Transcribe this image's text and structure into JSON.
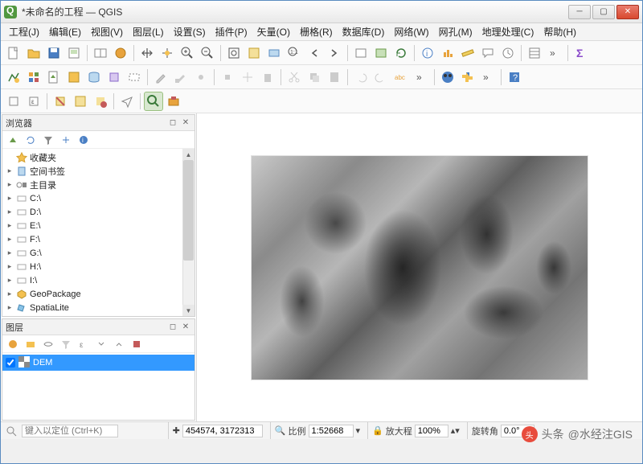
{
  "window": {
    "title": "*未命名的工程 — QGIS"
  },
  "menu": {
    "items": [
      "工程(J)",
      "编辑(E)",
      "视图(V)",
      "图层(L)",
      "设置(S)",
      "插件(P)",
      "矢量(O)",
      "栅格(R)",
      "数据库(D)",
      "网络(W)",
      "网孔(M)",
      "地理处理(C)",
      "帮助(H)"
    ]
  },
  "panels": {
    "browser": {
      "title": "浏览器"
    },
    "layers": {
      "title": "图层"
    }
  },
  "browser_tree": [
    {
      "icon": "star",
      "label": "收藏夹",
      "expandable": false
    },
    {
      "icon": "bookmark",
      "label": "空间书签",
      "expandable": true
    },
    {
      "icon": "home",
      "label": "主目录",
      "expandable": true
    },
    {
      "icon": "drive",
      "label": "C:\\",
      "expandable": true
    },
    {
      "icon": "drive",
      "label": "D:\\",
      "expandable": true
    },
    {
      "icon": "drive",
      "label": "E:\\",
      "expandable": true
    },
    {
      "icon": "drive",
      "label": "F:\\",
      "expandable": true
    },
    {
      "icon": "drive",
      "label": "G:\\",
      "expandable": true
    },
    {
      "icon": "drive",
      "label": "H:\\",
      "expandable": true
    },
    {
      "icon": "drive",
      "label": "I:\\",
      "expandable": true
    },
    {
      "icon": "geopackage",
      "label": "GeoPackage",
      "expandable": true
    },
    {
      "icon": "spatialite",
      "label": "SpatiaLite",
      "expandable": true
    }
  ],
  "layers": [
    {
      "checked": true,
      "name": "DEM"
    }
  ],
  "status": {
    "locate_placeholder": "键入以定位 (Ctrl+K)",
    "coord": "454574, 3172313",
    "scale_label": "比例",
    "scale": "1:52668",
    "mag_label": "放大程",
    "mag": "100%",
    "rot_label": "旋转角",
    "rot": "0.0°"
  },
  "watermark": {
    "prefix": "头条",
    "handle": "@水经注GIS"
  }
}
